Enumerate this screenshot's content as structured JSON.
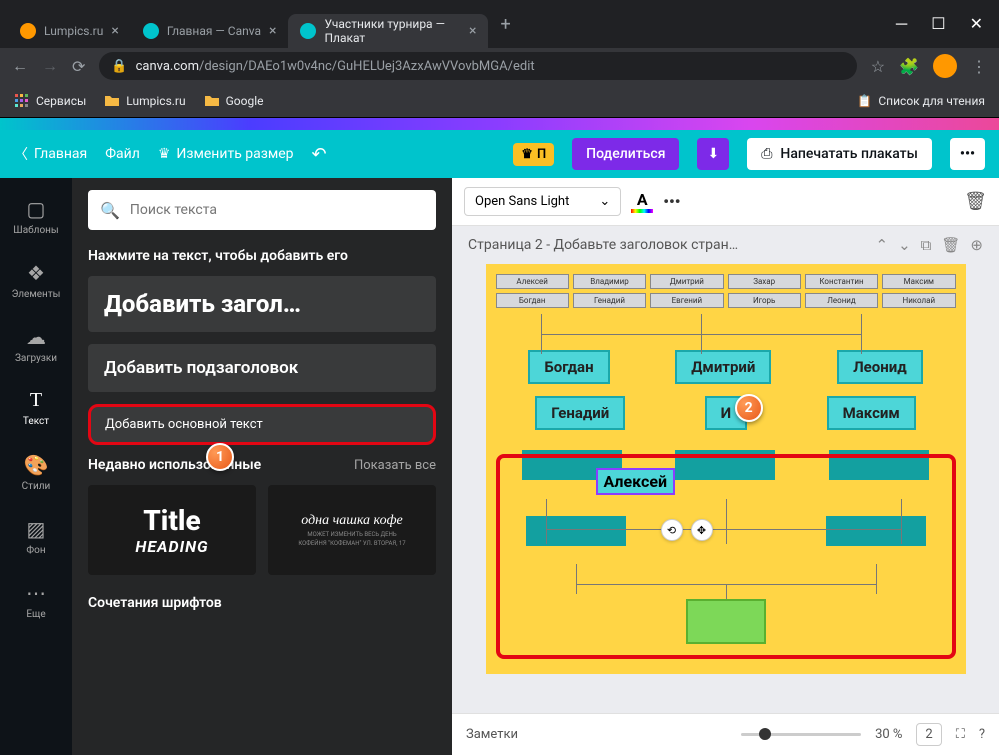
{
  "browser": {
    "tabs": [
      {
        "title": "Lumpics.ru",
        "favicon_color": "#ff9800"
      },
      {
        "title": "Главная — Canva",
        "favicon_color": "#00c4cc"
      },
      {
        "title": "Участники турнира — Плакат",
        "favicon_color": "#00c4cc"
      }
    ],
    "url_domain": "canva.com",
    "url_path": "/design/DAEo1w0v4nc/GuHELUej3AzxAwVVovbMGA/edit",
    "bookmarks": {
      "services": "Сервисы",
      "lumpics": "Lumpics.ru",
      "google": "Google",
      "reading_list": "Список для чтения"
    }
  },
  "toolbar": {
    "home": "Главная",
    "file": "Файл",
    "resize": "Изменить размер",
    "premium_short": "П",
    "share": "Поделиться",
    "print": "Напечатать плакаты"
  },
  "sidebar": {
    "items": [
      {
        "label": "Шаблоны"
      },
      {
        "label": "Элементы"
      },
      {
        "label": "Загрузки"
      },
      {
        "label": "Текст"
      },
      {
        "label": "Стили"
      },
      {
        "label": "Фон"
      },
      {
        "label": "Еще"
      }
    ]
  },
  "panel": {
    "search_placeholder": "Поиск текста",
    "hint": "Нажмите на текст, чтобы добавить его",
    "add_heading": "Добавить загол…",
    "add_subheading": "Добавить подзаголовок",
    "add_body": "Добавить основной текст",
    "recent_title": "Недавно использованные",
    "show_all": "Показать все",
    "thumb_title": "Title",
    "thumb_heading": "HEADING",
    "thumb_coffee": "одна чашка кофе",
    "thumb_coffee_sub1": "МОЖЕТ ИЗМЕНИТЬ ВЕСЬ ДЕНЬ",
    "thumb_coffee_sub2": "КОФЕЙНЯ \"КОФЕМАН\" УЛ. ВТОРАЯ, 17",
    "combos_title": "Сочетания шрифтов"
  },
  "canvas": {
    "font_name": "Open Sans Light",
    "page_label": "Страница 2 - Добавьте заголовок стран…",
    "notes_label": "Заметки",
    "zoom_value": "30 %",
    "page_count": "2",
    "top_names": [
      [
        "Алексей",
        "Владимир",
        "Дмитрий",
        "Захар",
        "Константин",
        "Максим"
      ],
      [
        "Богдан",
        "Генадий",
        "Евгений",
        "Игорь",
        "Леонид",
        "Николай"
      ]
    ],
    "round2": [
      "Богдан",
      "Дмитрий",
      "Леонид"
    ],
    "round3": [
      "Генадий",
      "И",
      "Максим"
    ],
    "selected": "Алексей",
    "badges": [
      "1",
      "2"
    ]
  }
}
